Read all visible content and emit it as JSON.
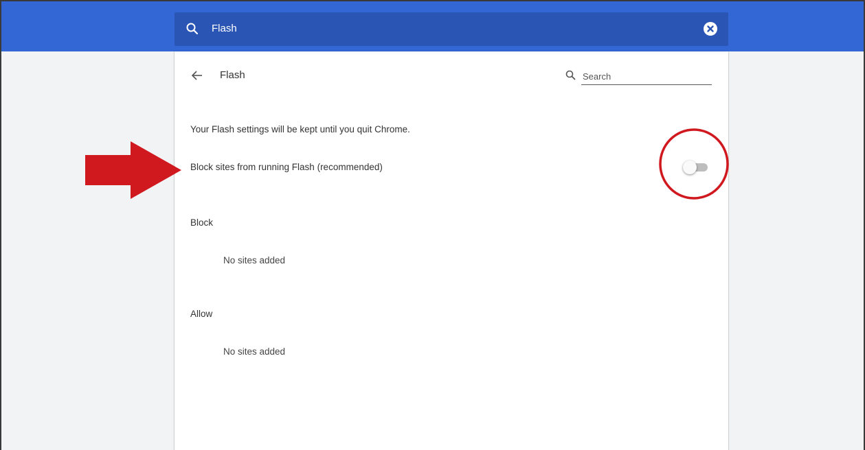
{
  "search": {
    "value": "Flash"
  },
  "page": {
    "title": "Flash",
    "search_placeholder": "Search",
    "note": "Your Flash settings will be kept until you quit Chrome.",
    "toggle_label": "Block sites from running Flash (recommended)",
    "toggle_on": false
  },
  "sections": {
    "block": {
      "heading": "Block",
      "empty": "No sites added"
    },
    "allow": {
      "heading": "Allow",
      "empty": "No sites added"
    }
  },
  "colors": {
    "header": "#3367d6",
    "searchbar": "#2a55b4",
    "annotation": "#d0181f"
  },
  "icons": {
    "search": "search-icon",
    "clear": "clear-icon",
    "back": "back-arrow-icon"
  }
}
